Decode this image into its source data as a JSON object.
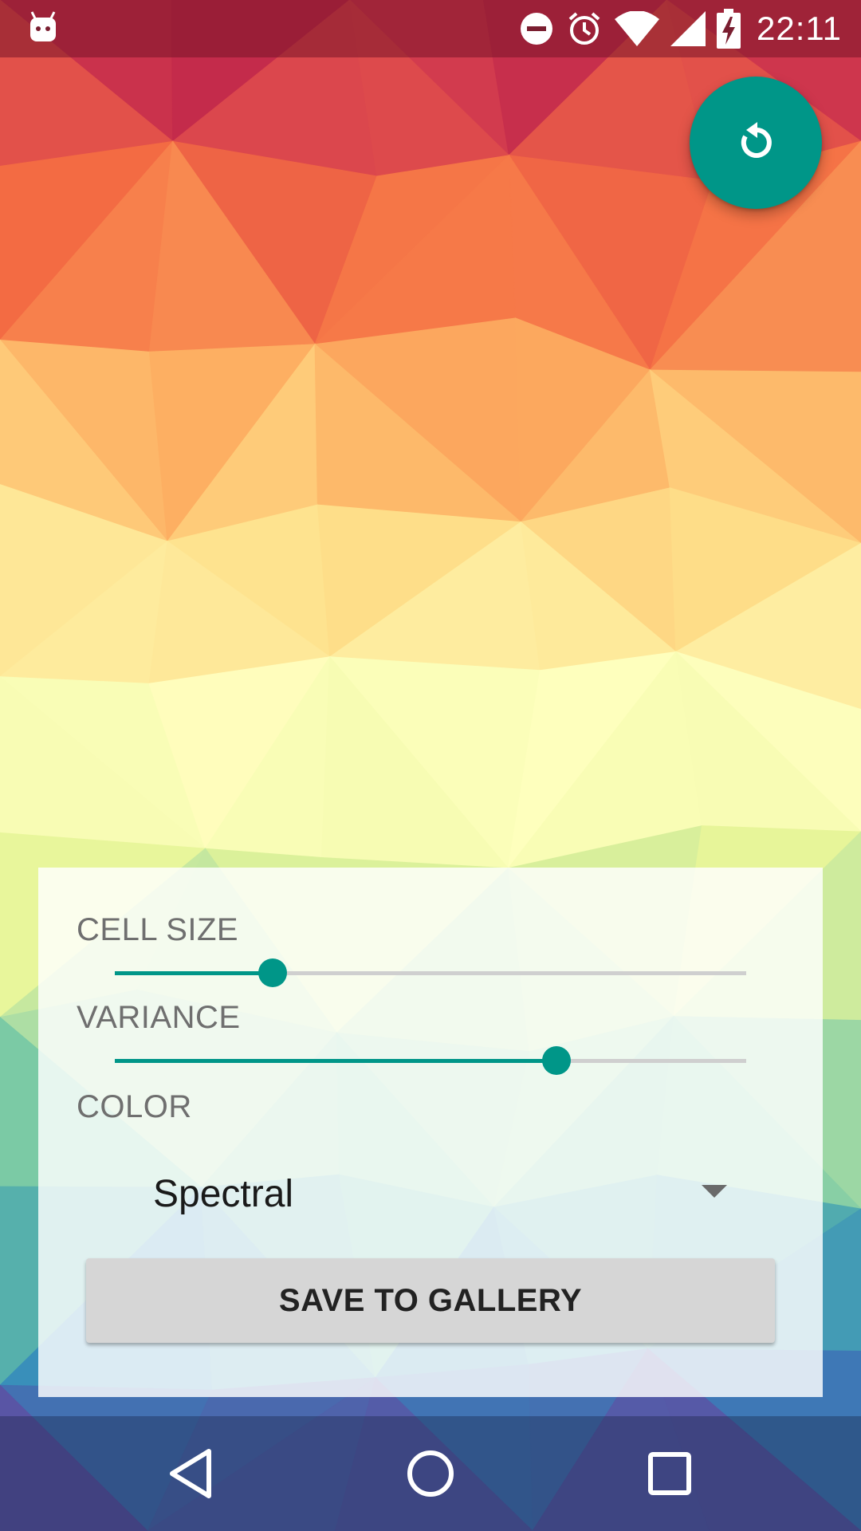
{
  "status_bar": {
    "time": "22:11",
    "icons": [
      "android-debug-icon",
      "do-not-disturb-icon",
      "alarm-icon",
      "wifi-icon",
      "cell-signal-icon",
      "battery-charging-icon"
    ]
  },
  "fab": {
    "icon": "refresh-icon",
    "color": "#009688"
  },
  "panel": {
    "cell_size": {
      "label": "CELL SIZE",
      "value_fraction": 0.25
    },
    "variance": {
      "label": "VARIANCE",
      "value_fraction": 0.7
    },
    "color": {
      "label": "COLOR",
      "selected": "Spectral"
    },
    "save_label": "SAVE TO GALLERY"
  },
  "nav_bar": {
    "icons": [
      "back-icon",
      "home-icon",
      "recents-icon"
    ]
  },
  "colors": {
    "accent": "#009688",
    "spectral": [
      "#9e0142",
      "#d53e4f",
      "#f46d43",
      "#fdae61",
      "#fee08b",
      "#ffffbf",
      "#e6f598",
      "#abdda4",
      "#66c2a5",
      "#3288bd",
      "#5e4fa2"
    ]
  }
}
